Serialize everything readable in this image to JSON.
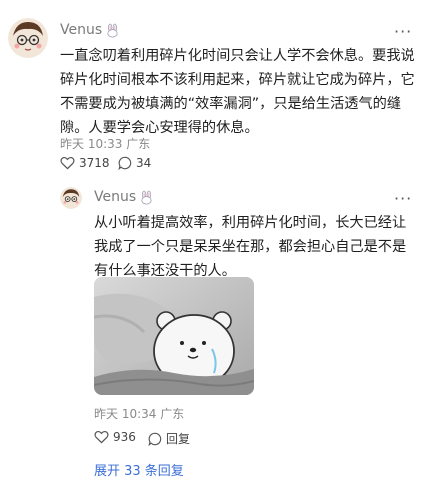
{
  "comment": {
    "author": "Venus",
    "author_icon": "rabbit-emoji-icon",
    "more_label": "···",
    "text_lines": [
      "一直念叨着利用碎片化时间只会让人学不会休息。要我说",
      "碎片化时间根本不该利用起来，碎片就让它成为碎片，它",
      "不需要成为被填满的“效率漏洞”，只是给生活透气的缝",
      "隙。人要学会心安理得的休息。"
    ],
    "meta": "昨天 10:33 广东",
    "likes": "3718",
    "replies": "34"
  },
  "reply": {
    "author": "Venus",
    "author_icon": "rabbit-emoji-icon",
    "more_label": "···",
    "text_lines": [
      "从小听着提高效率，利用碎片化时间，长大已经让",
      "我成了一个只是呆呆坐在那，都会担心自己是不是",
      "有什么事还没干的人。"
    ],
    "meta": "昨天 10:34 广东",
    "likes": "936",
    "reply_label": "回复"
  },
  "expand_label": "展开 33 条回复"
}
